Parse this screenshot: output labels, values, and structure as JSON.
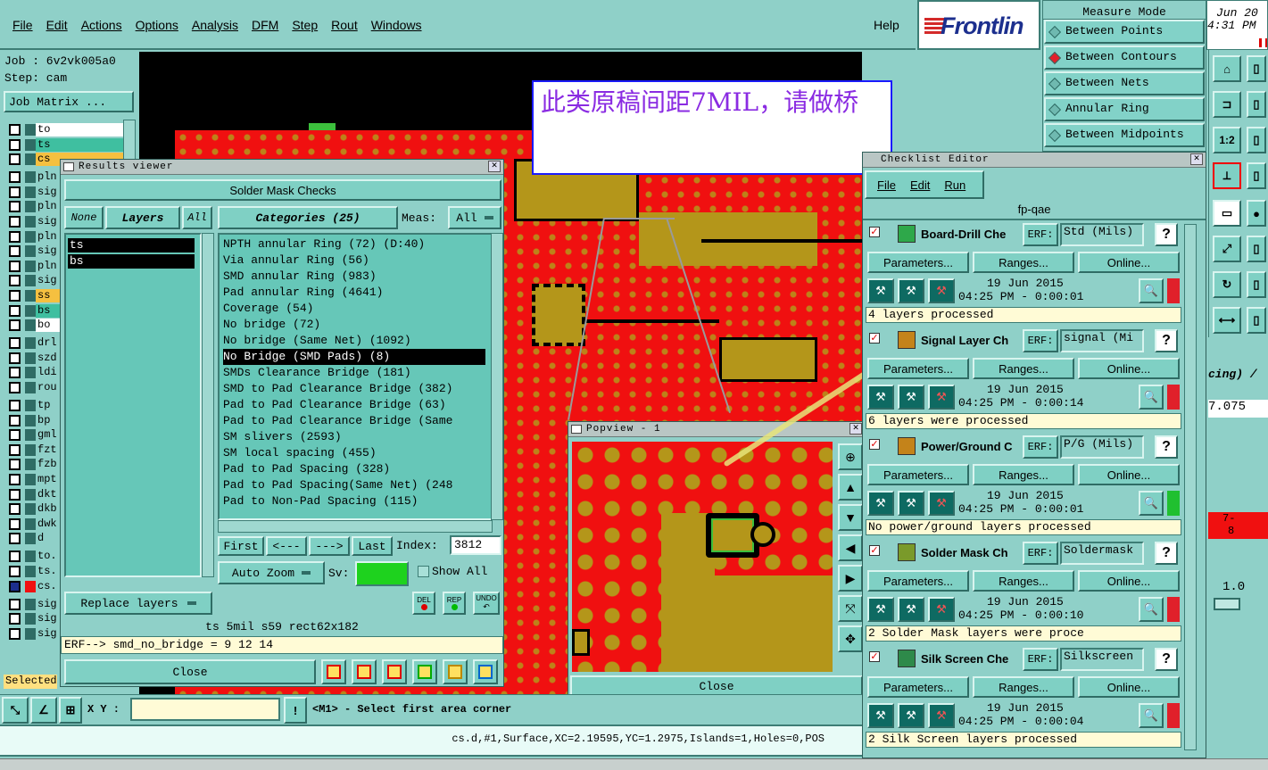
{
  "menu": {
    "items": [
      "File",
      "Edit",
      "Actions",
      "Options",
      "Analysis",
      "DFM",
      "Step",
      "Rout",
      "Windows"
    ],
    "help": "Help"
  },
  "brand": "Frontlin",
  "job": {
    "job_label": "Job : 6v2vk005a0",
    "step_label": "Step: cam",
    "matrix_button": "Job Matrix ..."
  },
  "layers": [
    "to",
    "ts",
    "cs",
    "pln",
    "sig",
    "pln",
    "sig",
    "pln",
    "sig",
    "pln",
    "sig",
    "ss",
    "bs",
    "bo",
    "drl",
    "szd",
    "ldi",
    "rou",
    "tp",
    "bp",
    "gml",
    "fzt",
    "fzb",
    "mpt",
    "dkt",
    "dkb",
    "dwk",
    "d",
    "to.",
    "ts.",
    "cs.",
    "sig",
    "sig",
    "sig"
  ],
  "selected_label": "Selected",
  "annotation": {
    "text": "此类原稿间距7MIL，请做桥"
  },
  "results_viewer": {
    "title": "Results viewer",
    "header": "Solder Mask Checks",
    "none_btn": "None",
    "layers_btn": "Layers",
    "all_btn": "All",
    "layer_list": [
      "ts",
      "bs"
    ],
    "categories_label": "Categories (25)",
    "meas_label": "Meas:",
    "meas_value": "All",
    "categories": [
      "NPTH annular Ring (72)      (D:40)",
      "Via annular Ring (56)",
      "SMD annular Ring (983)",
      "Pad annular Ring (4641)",
      "Coverage (54)",
      "No bridge (72)",
      "No bridge (Same Net) (1092)",
      "No Bridge (SMD Pads) (8)",
      "SMDs Clearance Bridge (181)",
      "SMD to Pad Clearance Bridge (382)",
      "Pad to Pad Clearance Bridge (63)",
      "Pad to Pad Clearance Bridge (Same",
      "SM slivers (2593)",
      "SM local spacing (455)",
      "Pad to Pad Spacing (328)",
      "Pad to Pad Spacing(Same Net) (248",
      "Pad to Non-Pad Spacing (115)"
    ],
    "selected_index": 7,
    "nav": {
      "first": "First",
      "prev": "<---",
      "next": "--->",
      "last": "Last",
      "index_label": "Index:",
      "index_value": "3812"
    },
    "auto_zoom": "Auto Zoom",
    "sv_label": "Sv:",
    "show_all": "Show All",
    "replace_layers": "Replace layers",
    "del": "DEL",
    "rep": "REP",
    "undo": "UNDO",
    "status1": "ts 5mil   s59   rect62x182",
    "status2": "ERF--> smd_no_bridge = 9 12 14",
    "close": "Close"
  },
  "popview": {
    "title": "Popview - 1",
    "close": "Close"
  },
  "measure_mode": {
    "title": "Measure Mode",
    "options": [
      "Between Points",
      "Between Contours",
      "Between Nets",
      "Annular Ring",
      "Between Midpoints"
    ],
    "selected": 1
  },
  "date_corner": {
    "line1": "Jun 20",
    "line2": "4:31 PM"
  },
  "checklist": {
    "title": "Checklist Editor",
    "menu": [
      "File",
      "Edit",
      "Run"
    ],
    "name": "fp-qae",
    "erf_label": "ERF:",
    "params_btn": "Parameters...",
    "ranges_btn": "Ranges...",
    "online_btn": "Online...",
    "checks": [
      {
        "name": "Board-Drill Che",
        "erf": "Std (Mils)",
        "date": "19 Jun 2015",
        "time": "04:25 PM - 0:00:01",
        "status": "4 layers processed",
        "flag": "#e0202a"
      },
      {
        "name": "Signal Layer Ch",
        "erf": "signal (Mi",
        "date": "19 Jun 2015",
        "time": "04:25 PM - 0:00:14",
        "status": "6 layers were processed",
        "flag": "#e0202a"
      },
      {
        "name": "Power/Ground C",
        "erf": "P/G (Mils)",
        "date": "19 Jun 2015",
        "time": "04:25 PM - 0:00:01",
        "status": "No power/ground layers processed",
        "flag": "#20c030"
      },
      {
        "name": "Solder Mask Ch",
        "erf": "Soldermask",
        "date": "19 Jun 2015",
        "time": "04:25 PM - 0:00:10",
        "status": "2 Solder Mask layers were proce",
        "flag": "#e0202a"
      },
      {
        "name": "Silk Screen Che",
        "erf": "Silkscreen",
        "date": "19 Jun 2015",
        "time": "04:25 PM - 0:00:04",
        "status": "2 Silk Screen layers processed",
        "flag": "#e0202a"
      }
    ]
  },
  "right_panel": {
    "spacing": "cing) /",
    "value1": "7.075",
    "value2": "7-",
    "value3": "8",
    "value4": "1.0"
  },
  "bottom": {
    "xy_label": "X Y :",
    "xy_value": "",
    "prompt": "<M1> - Select first area corner",
    "status": "cs.d,#1,Surface,XC=2.19595,YC=1.2975,Islands=1,Holes=0,POS"
  }
}
